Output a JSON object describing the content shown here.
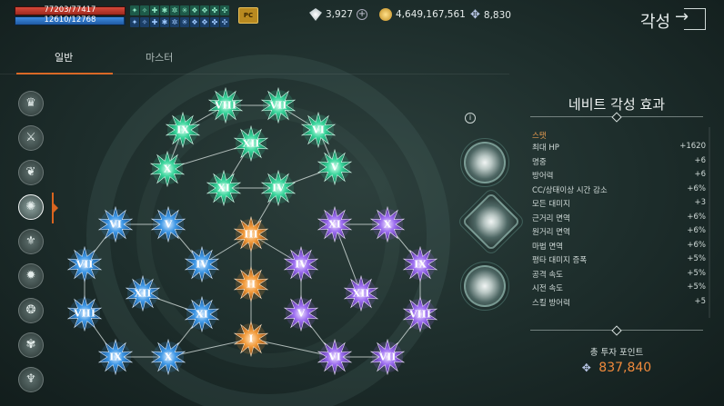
{
  "hud": {
    "hp_text": "77203/77417",
    "hp_percent": 99.7,
    "mp_text": "12610/12768",
    "mp_percent": 98.8,
    "pc_label": "PC"
  },
  "currency": {
    "diamond": "3,927",
    "gold": "4,649,167,561",
    "wing_points": "8,830"
  },
  "header": {
    "title": "각성"
  },
  "tabs": [
    {
      "label": "일반",
      "active": true
    },
    {
      "label": "마스터",
      "active": false
    }
  ],
  "sidebar": {
    "icon_count": 9,
    "selected_index": 3
  },
  "tree": {
    "nodes": [
      {
        "id": "g1",
        "label": "VIII",
        "color": "green"
      },
      {
        "id": "g2",
        "label": "VII",
        "color": "green"
      },
      {
        "id": "g3",
        "label": "IX",
        "color": "green"
      },
      {
        "id": "g4",
        "label": "VI",
        "color": "green"
      },
      {
        "id": "g5",
        "label": "XII",
        "color": "green"
      },
      {
        "id": "g6",
        "label": "X",
        "color": "green"
      },
      {
        "id": "g7",
        "label": "V",
        "color": "green"
      },
      {
        "id": "g8",
        "label": "XI",
        "color": "green"
      },
      {
        "id": "g9",
        "label": "IV",
        "color": "green"
      },
      {
        "id": "o1",
        "label": "III",
        "color": "orange"
      },
      {
        "id": "o2",
        "label": "II",
        "color": "orange"
      },
      {
        "id": "o3",
        "label": "I",
        "color": "orange"
      },
      {
        "id": "b1",
        "label": "VI",
        "color": "blue"
      },
      {
        "id": "b2",
        "label": "V",
        "color": "blue"
      },
      {
        "id": "b3",
        "label": "VII",
        "color": "blue"
      },
      {
        "id": "b4",
        "label": "IV",
        "color": "blue"
      },
      {
        "id": "b5",
        "label": "XII",
        "color": "blue"
      },
      {
        "id": "b6",
        "label": "VIII",
        "color": "blue"
      },
      {
        "id": "b7",
        "label": "XI",
        "color": "blue"
      },
      {
        "id": "b8",
        "label": "IX",
        "color": "blue"
      },
      {
        "id": "b9",
        "label": "X",
        "color": "blue"
      },
      {
        "id": "p1",
        "label": "XI",
        "color": "purple"
      },
      {
        "id": "p2",
        "label": "X",
        "color": "purple"
      },
      {
        "id": "p3",
        "label": "IV",
        "color": "purple"
      },
      {
        "id": "p4",
        "label": "IX",
        "color": "purple"
      },
      {
        "id": "p5",
        "label": "XII",
        "color": "purple"
      },
      {
        "id": "p6",
        "label": "V",
        "color": "purple"
      },
      {
        "id": "p7",
        "label": "VIII",
        "color": "purple"
      },
      {
        "id": "p8",
        "label": "VI",
        "color": "purple"
      },
      {
        "id": "p9",
        "label": "VII",
        "color": "purple"
      }
    ]
  },
  "effects_panel": {
    "title": "네비트 각성 효과",
    "section": "스탯",
    "stats": [
      {
        "name": "최대 HP",
        "value": "+1620"
      },
      {
        "name": "명중",
        "value": "+6"
      },
      {
        "name": "방어력",
        "value": "+6"
      },
      {
        "name": "CC/상태이상 시간 감소",
        "value": "+6%"
      },
      {
        "name": "모든 대미지",
        "value": "+3"
      },
      {
        "name": "근거리 면역",
        "value": "+6%"
      },
      {
        "name": "원거리 면역",
        "value": "+6%"
      },
      {
        "name": "마법 면역",
        "value": "+6%"
      },
      {
        "name": "평타 대미지 증폭",
        "value": "+5%"
      },
      {
        "name": "공격 속도",
        "value": "+5%"
      },
      {
        "name": "시전 속도",
        "value": "+5%"
      },
      {
        "name": "스킬 방어력",
        "value": "+5"
      }
    ],
    "total_label": "총 투자 포인트",
    "total_value": "837,840"
  }
}
